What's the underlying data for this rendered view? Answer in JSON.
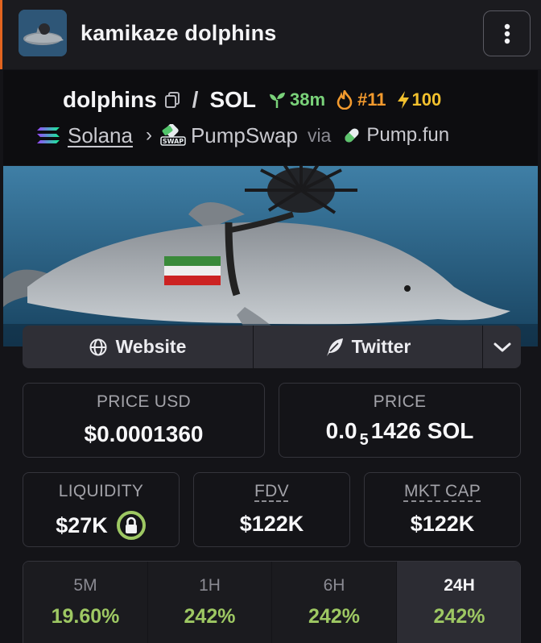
{
  "header": {
    "title": "kamikaze dolphins",
    "avatar_icon": "dolphin-avatar-icon",
    "menu_icon": "kebab-menu-icon"
  },
  "pair": {
    "base_symbol": "dolphins",
    "separator": "/",
    "quote_symbol": "SOL",
    "age": "38m",
    "rank": "#11",
    "boosts": "100",
    "chain": "Solana",
    "dex": "PumpSwap",
    "via_label": "via",
    "launchpad": "Pump.fun"
  },
  "links": {
    "website_label": "Website",
    "twitter_label": "Twitter"
  },
  "stats": {
    "price_usd_label": "PRICE USD",
    "price_usd_value": "$0.0001360",
    "price_native_label": "PRICE",
    "price_native_prefix": "0.0",
    "price_native_zeros": "5",
    "price_native_digits": "1426 SOL",
    "liquidity_label": "LIQUIDITY",
    "liquidity_value": "$27K",
    "fdv_label": "FDV",
    "fdv_value": "$122K",
    "mkt_cap_label": "MKT CAP",
    "mkt_cap_value": "$122K"
  },
  "timeframes": [
    {
      "label": "5M",
      "value": "19.60%",
      "active": false
    },
    {
      "label": "1H",
      "value": "242%",
      "active": false
    },
    {
      "label": "6H",
      "value": "242%",
      "active": false
    },
    {
      "label": "24H",
      "value": "242%",
      "active": true
    }
  ],
  "colors": {
    "accent_orange": "#e2641f",
    "positive_green": "#9ec863",
    "age_green": "#7ad27a",
    "rank_orange": "#f39a2e",
    "boost_yellow": "#f2c12e"
  }
}
